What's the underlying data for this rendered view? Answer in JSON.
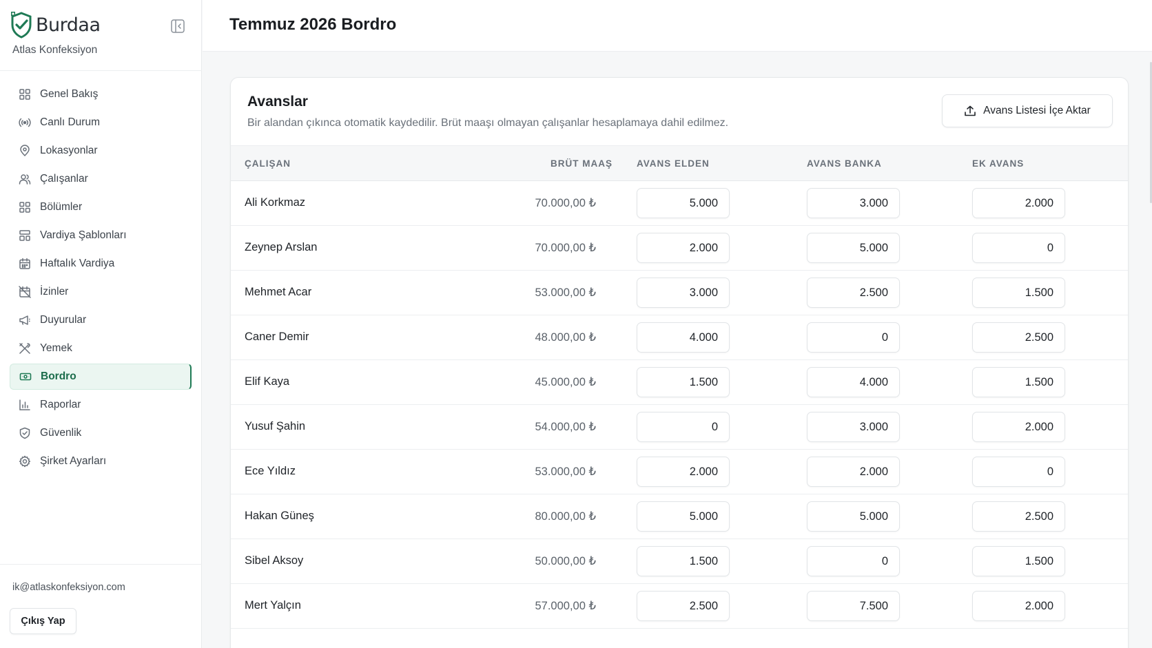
{
  "brand": {
    "name": "Burdaa",
    "company": "Atlas Konfeksiyon"
  },
  "sidebar": {
    "items": [
      {
        "label": "Genel Bakış",
        "icon": "grid-icon"
      },
      {
        "label": "Canlı Durum",
        "icon": "broadcast-icon"
      },
      {
        "label": "Lokasyonlar",
        "icon": "map-pin-icon"
      },
      {
        "label": "Çalışanlar",
        "icon": "users-icon"
      },
      {
        "label": "Bölümler",
        "icon": "grid-icon"
      },
      {
        "label": "Vardiya Şablonları",
        "icon": "template-icon"
      },
      {
        "label": "Haftalık Vardiya",
        "icon": "calendar-icon"
      },
      {
        "label": "İzinler",
        "icon": "calendar-off-icon"
      },
      {
        "label": "Duyurular",
        "icon": "megaphone-icon"
      },
      {
        "label": "Yemek",
        "icon": "utensils-icon"
      },
      {
        "label": "Bordro",
        "icon": "banknote-icon",
        "active": true
      },
      {
        "label": "Raporlar",
        "icon": "bar-chart-icon"
      },
      {
        "label": "Güvenlik",
        "icon": "shield-check-icon"
      },
      {
        "label": "Şirket Ayarları",
        "icon": "settings-icon"
      }
    ],
    "user_email": "ik@atlaskonfeksiyon.com",
    "logout_label": "Çıkış Yap"
  },
  "header": {
    "title": "Temmuz 2026 Bordro"
  },
  "card": {
    "title": "Avanslar",
    "description": "Bir alandan çıkınca otomatik kaydedilir. Brüt maaşı olmayan çalışanlar hesaplamaya dahil edilmez.",
    "import_label": "Avans Listesi İçe Aktar",
    "columns": {
      "employee": "ÇALIŞAN",
      "gross_salary": "BRÜT MAAŞ",
      "advance_cash": "AVANS ELDEN",
      "advance_bank": "AVANS BANKA",
      "extra_advance": "EK AVANS"
    },
    "rows": [
      {
        "name": "Ali Korkmaz",
        "salary": "70.000,00 ₺",
        "cash": "5.000",
        "bank": "3.000",
        "extra": "2.000"
      },
      {
        "name": "Zeynep Arslan",
        "salary": "70.000,00 ₺",
        "cash": "2.000",
        "bank": "5.000",
        "extra": "0"
      },
      {
        "name": "Mehmet Acar",
        "salary": "53.000,00 ₺",
        "cash": "3.000",
        "bank": "2.500",
        "extra": "1.500"
      },
      {
        "name": "Caner Demir",
        "salary": "48.000,00 ₺",
        "cash": "4.000",
        "bank": "0",
        "extra": "2.500"
      },
      {
        "name": "Elif Kaya",
        "salary": "45.000,00 ₺",
        "cash": "1.500",
        "bank": "4.000",
        "extra": "1.500"
      },
      {
        "name": "Yusuf Şahin",
        "salary": "54.000,00 ₺",
        "cash": "0",
        "bank": "3.000",
        "extra": "2.000"
      },
      {
        "name": "Ece Yıldız",
        "salary": "53.000,00 ₺",
        "cash": "2.000",
        "bank": "2.000",
        "extra": "0"
      },
      {
        "name": "Hakan Güneş",
        "salary": "80.000,00 ₺",
        "cash": "5.000",
        "bank": "5.000",
        "extra": "2.500"
      },
      {
        "name": "Sibel Aksoy",
        "salary": "50.000,00 ₺",
        "cash": "1.500",
        "bank": "0",
        "extra": "1.500"
      },
      {
        "name": "Mert Yalçın",
        "salary": "57.000,00 ₺",
        "cash": "2.500",
        "bank": "7.500",
        "extra": "2.000"
      }
    ]
  },
  "colors": {
    "accent": "#1f7a55",
    "accent_bg": "#ebf6f1",
    "text": "#1f2328",
    "muted": "#6a717a"
  }
}
